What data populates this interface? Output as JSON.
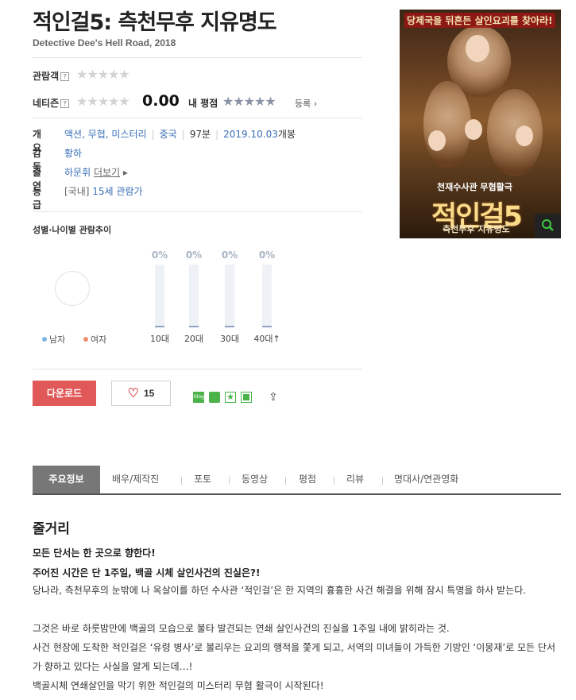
{
  "movie": {
    "title": "적인걸5: 측천무후 지유명도",
    "subtitle": "Detective Dee's Hell Road, 2018"
  },
  "ratings": {
    "audience_label": "관람객",
    "netizen_label": "네티즌",
    "help_icon": "?",
    "stars_empty": "★★★★★",
    "netizen_score": "0.00",
    "my_rating_label": "내 평점",
    "register_label": "등록"
  },
  "info": {
    "overview_label": "개요",
    "genres": "액션, 무협, 미스터리",
    "country": "중국",
    "runtime": "97분",
    "release_date": "2019.10.03",
    "release_suffix": "개봉",
    "director_label": "감독",
    "director": "황하",
    "cast_label": "출연",
    "cast": "하문휘",
    "cast_more": "더보기",
    "grade_label": "등급",
    "grade_prefix": "[국내]",
    "grade": "15세 관람가"
  },
  "poster": {
    "tagline": "당제국을 뒤흔든 살인요괴를 찾아라!",
    "crime_line": "천재수사관 무협활극",
    "big_title": "적인걸5",
    "sub_title": "측천무후 지유명도",
    "zoom_icon": "magnifier-icon"
  },
  "chart_data": {
    "type": "bar",
    "title": "성별·나이별 관람추이",
    "gender_legend": [
      {
        "name": "남자",
        "color": "#7fb4e6"
      },
      {
        "name": "여자",
        "color": "#ef8a6a"
      }
    ],
    "categories": [
      "10대",
      "20대",
      "30대",
      "40대↑"
    ],
    "values": [
      0,
      0,
      0,
      0
    ],
    "value_labels": [
      "0%",
      "0%",
      "0%",
      "0%"
    ],
    "ylim": [
      0,
      100
    ]
  },
  "actions": {
    "download_label": "다운로드",
    "like_count": "15",
    "share_icons": [
      "blog-icon",
      "cafe-icon",
      "bookmark-star-icon",
      "memo-icon"
    ],
    "share_button": "share-icon"
  },
  "tabs": [
    "주요정보",
    "배우/제작진",
    "포토",
    "동영상",
    "평점",
    "리뷰",
    "명대사/연관영화"
  ],
  "synopsis": {
    "heading": "줄거리",
    "bold1": "모든 단서는 한 곳으로 향한다!",
    "bold2": "주어진 시간은 단 1주일, 백골 시체 살인사건의 진실은?!",
    "p1": "당나라, 측천무후의 눈밖에 나 옥살이를 하던 수사관 ‘적인걸’은 한 지역의 흉흉한 사건 해결을 위해 잠시 특명을 하사 받는다.",
    "p2": " 그것은 바로 하룻밤만에 백골의 모습으로 불타 발견되는 연쇄 살인사건의 진실을 1주일 내에 밝히라는 것.",
    "p3": " 사건 현장에 도착한 적인걸은 ‘유령 병사’로 불리우는 요괴의 행적을 쫓게 되고, 서역의 미녀들이 가득한 기방인 ‘이몽재’로 모든 단서가 향하고 있다는 사실을 알게 되는데…!",
    "p4": " 백골시체 연쇄살인을 막기 위한 적인걸의 미스터리 무협 활극이 시작된다!"
  }
}
